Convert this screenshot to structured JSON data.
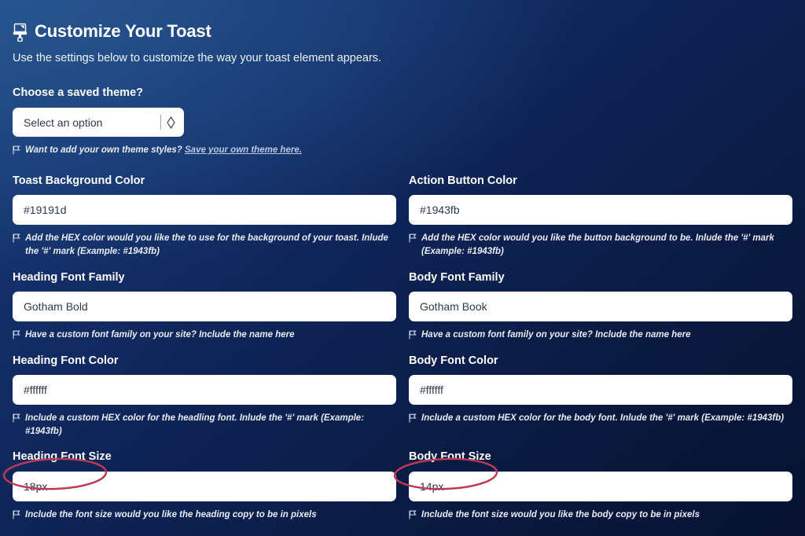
{
  "header": {
    "icon": "paint-brush-icon",
    "title": "Customize Your Toast",
    "subtitle": "Use the settings below to customize the way your toast element appears."
  },
  "theme_select": {
    "label": "Choose a saved theme?",
    "value": "Select an option",
    "indicator_icon": "chevron-up-down-icon",
    "hint_icon": "flag-icon",
    "hint_text": "Want to add your own theme styles?",
    "hint_link": "Save your own theme here."
  },
  "fields": [
    {
      "name": "toast-background-color",
      "label": "Toast Background Color",
      "value": "#19191d",
      "hint": "Add the HEX color would you like the to use for the background of your toast. Inlude the '#' mark (Example: #1943fb)"
    },
    {
      "name": "action-button-color",
      "label": "Action Button Color",
      "value": "#1943fb",
      "hint": "Add the HEX color would you like the button background to be. Inlude the '#' mark (Example: #1943fb)"
    },
    {
      "name": "heading-font-family",
      "label": "Heading Font Family",
      "value": "Gotham Bold",
      "hint": "Have a custom font family on your site? Include the name here"
    },
    {
      "name": "body-font-family",
      "label": "Body Font Family",
      "value": "Gotham Book",
      "hint": "Have a custom font family on your site? Include the name here"
    },
    {
      "name": "heading-font-color",
      "label": "Heading Font Color",
      "value": "#ffffff",
      "hint": "Include a custom HEX color for the headling font. Inlude the '#' mark (Example: #1943fb)"
    },
    {
      "name": "body-font-color",
      "label": "Body Font Color",
      "value": "#ffffff",
      "hint": "Include a custom HEX color for the body font. Inlude the '#' mark (Example: #1943fb)"
    },
    {
      "name": "heading-font-size",
      "label": "Heading Font Size",
      "value": "18px",
      "hint": "Include the font size would you like the heading copy to be in pixels"
    },
    {
      "name": "body-font-size",
      "label": "Body Font Size",
      "value": "14px",
      "hint": "Include the font size would you like the body copy to be in pixels"
    }
  ],
  "annotations": {
    "color": "#bc3a52",
    "shapes": [
      {
        "name": "heading-font-size-highlight"
      },
      {
        "name": "body-font-size-highlight"
      }
    ]
  },
  "colors": {
    "background_start": "#1c4179",
    "background_end": "#081331",
    "input_background": "#ffffff",
    "text": "#ffffff",
    "annotation": "#bc3a52"
  }
}
